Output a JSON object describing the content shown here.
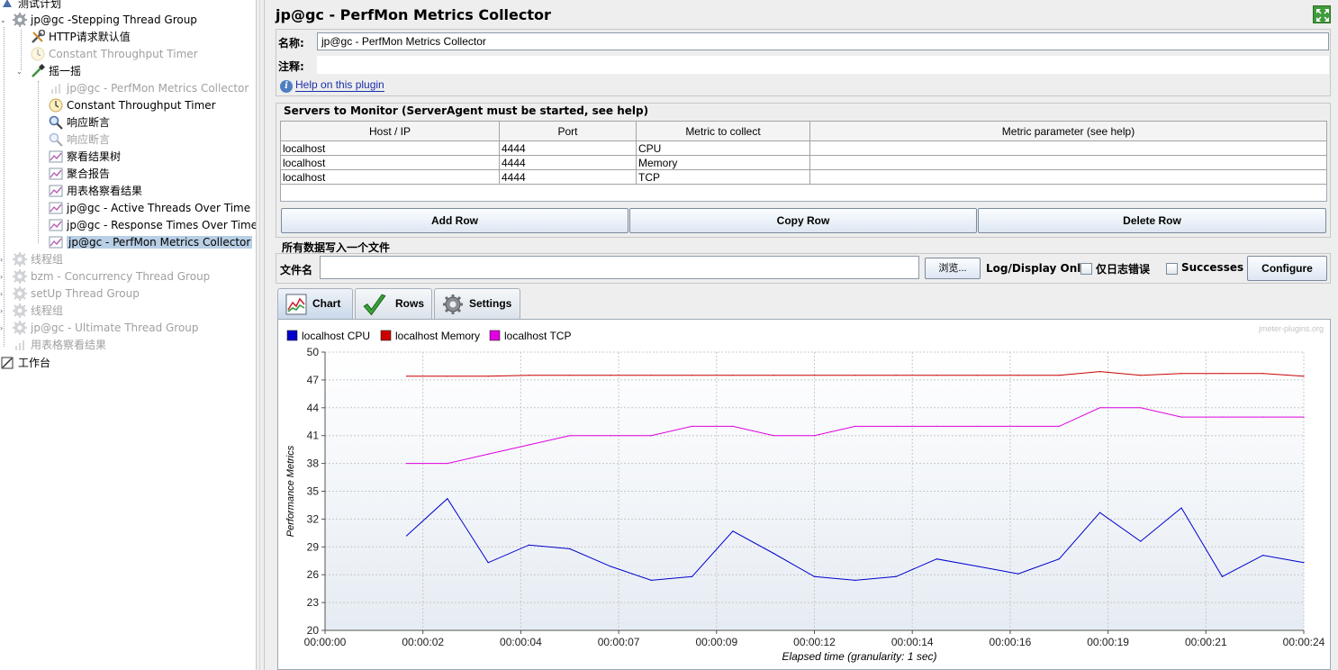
{
  "tree": {
    "items": [
      {
        "label": "测试计划",
        "disabled": false,
        "selected": false,
        "icon": "test-plan-icon"
      },
      {
        "label": "jp@gc -Stepping Thread Group",
        "disabled": false,
        "selected": false,
        "icon": "gear-icon"
      },
      {
        "label": "HTTP请求默认值",
        "disabled": false,
        "selected": false,
        "icon": "wrench-icon"
      },
      {
        "label": "Constant Throughput Timer",
        "disabled": true,
        "selected": false,
        "icon": "timer-icon"
      },
      {
        "label": "摇一摇",
        "disabled": false,
        "selected": false,
        "icon": "pipette-icon"
      },
      {
        "label": "jp@gc - PerfMon Metrics Collector",
        "disabled": true,
        "selected": false,
        "icon": "chart-icon"
      },
      {
        "label": "Constant Throughput Timer",
        "disabled": false,
        "selected": false,
        "icon": "timer-icon"
      },
      {
        "label": "响应断言",
        "disabled": false,
        "selected": false,
        "icon": "magnifier-icon"
      },
      {
        "label": "响应断言",
        "disabled": true,
        "selected": false,
        "icon": "magnifier-icon"
      },
      {
        "label": "察看结果树",
        "disabled": false,
        "selected": false,
        "icon": "listener-icon"
      },
      {
        "label": "聚合报告",
        "disabled": false,
        "selected": false,
        "icon": "listener-icon"
      },
      {
        "label": "用表格察看结果",
        "disabled": false,
        "selected": false,
        "icon": "listener-icon"
      },
      {
        "label": "jp@gc - Active Threads Over Time",
        "disabled": false,
        "selected": false,
        "icon": "listener-icon"
      },
      {
        "label": "jp@gc - Response Times Over Time",
        "disabled": false,
        "selected": false,
        "icon": "listener-icon"
      },
      {
        "label": "jp@gc - PerfMon Metrics Collector",
        "disabled": false,
        "selected": true,
        "icon": "listener-icon"
      },
      {
        "label": "线程组",
        "disabled": true,
        "selected": false,
        "icon": "gear-icon"
      },
      {
        "label": "bzm - Concurrency Thread Group",
        "disabled": true,
        "selected": false,
        "icon": "gear-icon"
      },
      {
        "label": "setUp Thread Group",
        "disabled": true,
        "selected": false,
        "icon": "gear-icon"
      },
      {
        "label": "线程组",
        "disabled": true,
        "selected": false,
        "icon": "gear-icon"
      },
      {
        "label": "jp@gc - Ultimate Thread Group",
        "disabled": true,
        "selected": false,
        "icon": "gear-icon"
      },
      {
        "label": "用表格察看结果",
        "disabled": true,
        "selected": false,
        "icon": "chart-icon"
      },
      {
        "label": "工作台",
        "disabled": false,
        "selected": false,
        "icon": "workbench-icon"
      }
    ]
  },
  "header": {
    "title": "jp@gc - PerfMon Metrics Collector"
  },
  "form": {
    "name_label": "名称:",
    "name_value": "jp@gc - PerfMon Metrics Collector",
    "comment_label": "注释:",
    "comment_value": "",
    "help_link": "Help on this plugin"
  },
  "servers": {
    "title": "Servers to Monitor (ServerAgent must be started, see help)",
    "columns": [
      "Host / IP",
      "Port",
      "Metric to collect",
      "Metric parameter (see help)"
    ],
    "rows": [
      [
        "localhost",
        "4444",
        "CPU",
        ""
      ],
      [
        "localhost",
        "4444",
        "Memory",
        ""
      ],
      [
        "localhost",
        "4444",
        "TCP",
        ""
      ]
    ],
    "add_row": "Add Row",
    "copy_row": "Copy Row",
    "delete_row": "Delete Row"
  },
  "file": {
    "section_title": "所有数据写入一个文件",
    "filename_label": "文件名",
    "filename_value": "",
    "browse_button": "浏览...",
    "log_display_label": "Log/Display Only:",
    "errors_only_label": "仅日志错误",
    "errors_only_checked": false,
    "successes_label": "Successes",
    "successes_checked": false,
    "configure_button": "Configure"
  },
  "tabs": [
    {
      "label": "Chart",
      "active": true,
      "icon": "chart-tab-icon"
    },
    {
      "label": "Rows",
      "active": false,
      "icon": "checkmark-icon"
    },
    {
      "label": "Settings",
      "active": false,
      "icon": "gear-icon"
    }
  ],
  "colors": {
    "cpu": "#0000cc",
    "memory": "#cc0000",
    "tcp": "#e000e0",
    "selection": "#b8cfe5"
  },
  "chart_data": {
    "type": "line",
    "watermark": "jmeter-plugins.org",
    "xlabel": "Elapsed time (granularity: 1 sec)",
    "ylabel": "Performance Metrics",
    "xlim": [
      0,
      24
    ],
    "ylim": [
      20,
      50
    ],
    "yticks": [
      20,
      23,
      26,
      29,
      32,
      35,
      38,
      41,
      44,
      47,
      50
    ],
    "x_tick_labels": [
      "00:00:00",
      "00:00:02",
      "00:00:04",
      "00:00:07",
      "00:00:09",
      "00:00:12",
      "00:00:14",
      "00:00:16",
      "00:00:19",
      "00:00:21",
      "00:00:24"
    ],
    "grid": true,
    "legend": "top-left",
    "series": [
      {
        "name": "localhost CPU",
        "color": "#0000cc",
        "x": [
          2,
          3,
          4,
          5,
          6,
          7,
          8,
          9,
          10,
          11,
          12,
          13,
          14,
          15,
          16,
          17,
          18,
          19,
          20,
          21,
          22,
          23,
          24
        ],
        "values": [
          30.2,
          34.2,
          27.3,
          29.2,
          28.8,
          26.9,
          25.4,
          25.8,
          30.7,
          28.3,
          25.8,
          25.4,
          25.8,
          27.7,
          26.9,
          26.1,
          27.7,
          32.7,
          29.6,
          33.2,
          25.8,
          28.1,
          27.3
        ]
      },
      {
        "name": "localhost Memory",
        "color": "#cc0000",
        "x": [
          2,
          3,
          4,
          5,
          6,
          7,
          8,
          9,
          10,
          11,
          12,
          13,
          14,
          15,
          16,
          17,
          18,
          19,
          20,
          21,
          22,
          23,
          24
        ],
        "values": [
          47.4,
          47.4,
          47.4,
          47.5,
          47.5,
          47.5,
          47.5,
          47.5,
          47.5,
          47.5,
          47.5,
          47.5,
          47.5,
          47.5,
          47.5,
          47.5,
          47.5,
          47.9,
          47.5,
          47.7,
          47.7,
          47.7,
          47.4
        ]
      },
      {
        "name": "localhost TCP",
        "color": "#e000e0",
        "x": [
          2,
          3,
          4,
          5,
          6,
          7,
          8,
          9,
          10,
          11,
          12,
          13,
          14,
          15,
          16,
          17,
          18,
          19,
          20,
          21,
          22,
          23,
          24
        ],
        "values": [
          38,
          38,
          39,
          40,
          41,
          41,
          41,
          42,
          42,
          41,
          41,
          42,
          42,
          42,
          42,
          42,
          42,
          44,
          44,
          43,
          43,
          43,
          43
        ]
      }
    ]
  }
}
